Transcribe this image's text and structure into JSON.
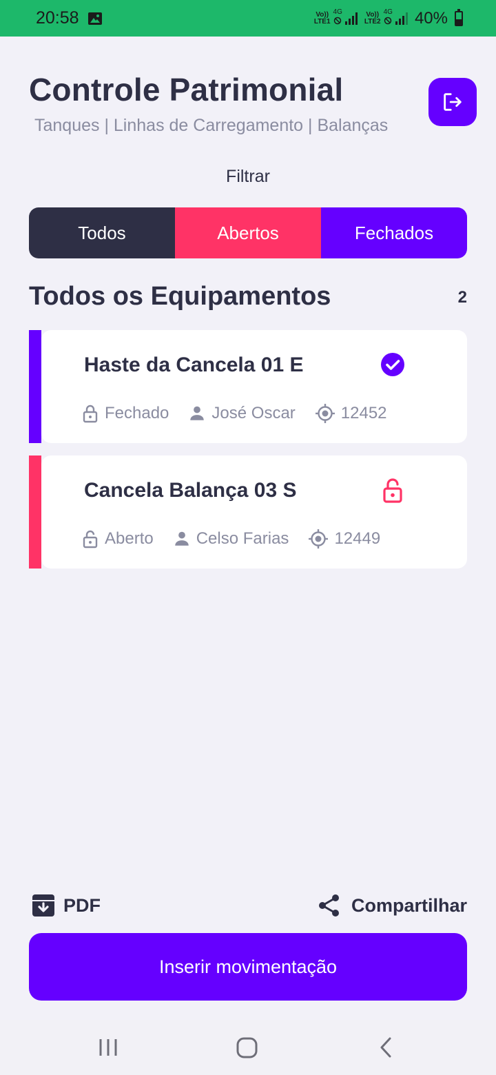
{
  "status_bar": {
    "time": "20:58",
    "sim1_label_top": "Vo))",
    "sim1_label_bottom": "LTE1",
    "sim2_label_top": "Vo))",
    "sim2_label_bottom": "LTE2",
    "network_type": "4G",
    "battery_percent": "40%",
    "battery_level": 0.4
  },
  "header": {
    "title": "Controle Patrimonial",
    "subtitle": "Tanques | Linhas de Carregamento | Balanças"
  },
  "filter": {
    "label": "Filtrar",
    "tabs": [
      {
        "label": "Todos",
        "color": "#2e2f45"
      },
      {
        "label": "Abertos",
        "color": "#ff3366"
      },
      {
        "label": "Fechados",
        "color": "#6500ff"
      }
    ]
  },
  "section": {
    "title": "Todos os Equipamentos",
    "count": "2"
  },
  "equipment": [
    {
      "name": "Haste da Cancela 01 E",
      "status": "Fechado",
      "status_icon": "check-circle-icon",
      "user": "José Oscar",
      "code": "12452",
      "accent": "#6500ff"
    },
    {
      "name": "Cancela Balança 03 S",
      "status": "Aberto",
      "status_icon": "unlock-icon",
      "user": "Celso Farias",
      "code": "12449",
      "accent": "#ff3366"
    }
  ],
  "actions": {
    "pdf_label": "PDF",
    "share_label": "Compartilhar",
    "primary_label": "Inserir movimentação"
  },
  "colors": {
    "primary": "#6500ff",
    "open": "#ff3366",
    "dark": "#2e2f45",
    "muted": "#8a8ca0",
    "status_bar": "#1db86a"
  }
}
